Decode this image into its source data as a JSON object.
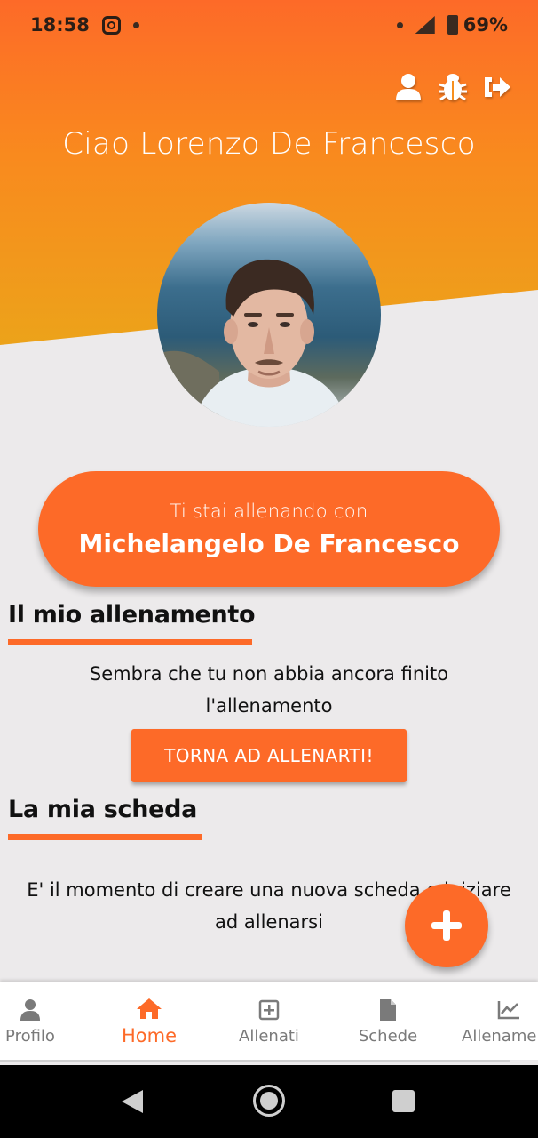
{
  "status_bar": {
    "time": "18:58",
    "battery": "69%"
  },
  "header": {
    "greeting": "Ciao Lorenzo De Francesco",
    "actions": [
      "profile-icon",
      "bug-icon",
      "logout-icon"
    ]
  },
  "trainer": {
    "subtitle": "Ti stai allenando con",
    "name": "Michelangelo De Francesco"
  },
  "workout_section": {
    "title": "Il mio allenamento",
    "message_line1": "Sembra che tu non abbia ancora finito",
    "message_line2": "l'allenamento",
    "button_label": "TORNA AD ALLENARTI!"
  },
  "plan_section": {
    "title": "La mia scheda",
    "message_line1": "E' il momento di creare una nuova scheda e iniziare",
    "message_line2": "ad allenarsi"
  },
  "fab": {
    "icon": "plus-icon"
  },
  "bottom_nav": {
    "items": [
      {
        "label": "Profilo",
        "icon": "user-icon",
        "active": false
      },
      {
        "label": "Home",
        "icon": "home-icon",
        "active": true
      },
      {
        "label": "Allenati",
        "icon": "plus-square-icon",
        "active": false
      },
      {
        "label": "Schede",
        "icon": "document-icon",
        "active": false
      },
      {
        "label": "Allenamenti",
        "icon": "chart-line-icon",
        "active": false
      }
    ]
  },
  "colors": {
    "accent": "#fd6a28",
    "background": "#eceaeb",
    "inactive_nav": "#7a7a7a"
  }
}
